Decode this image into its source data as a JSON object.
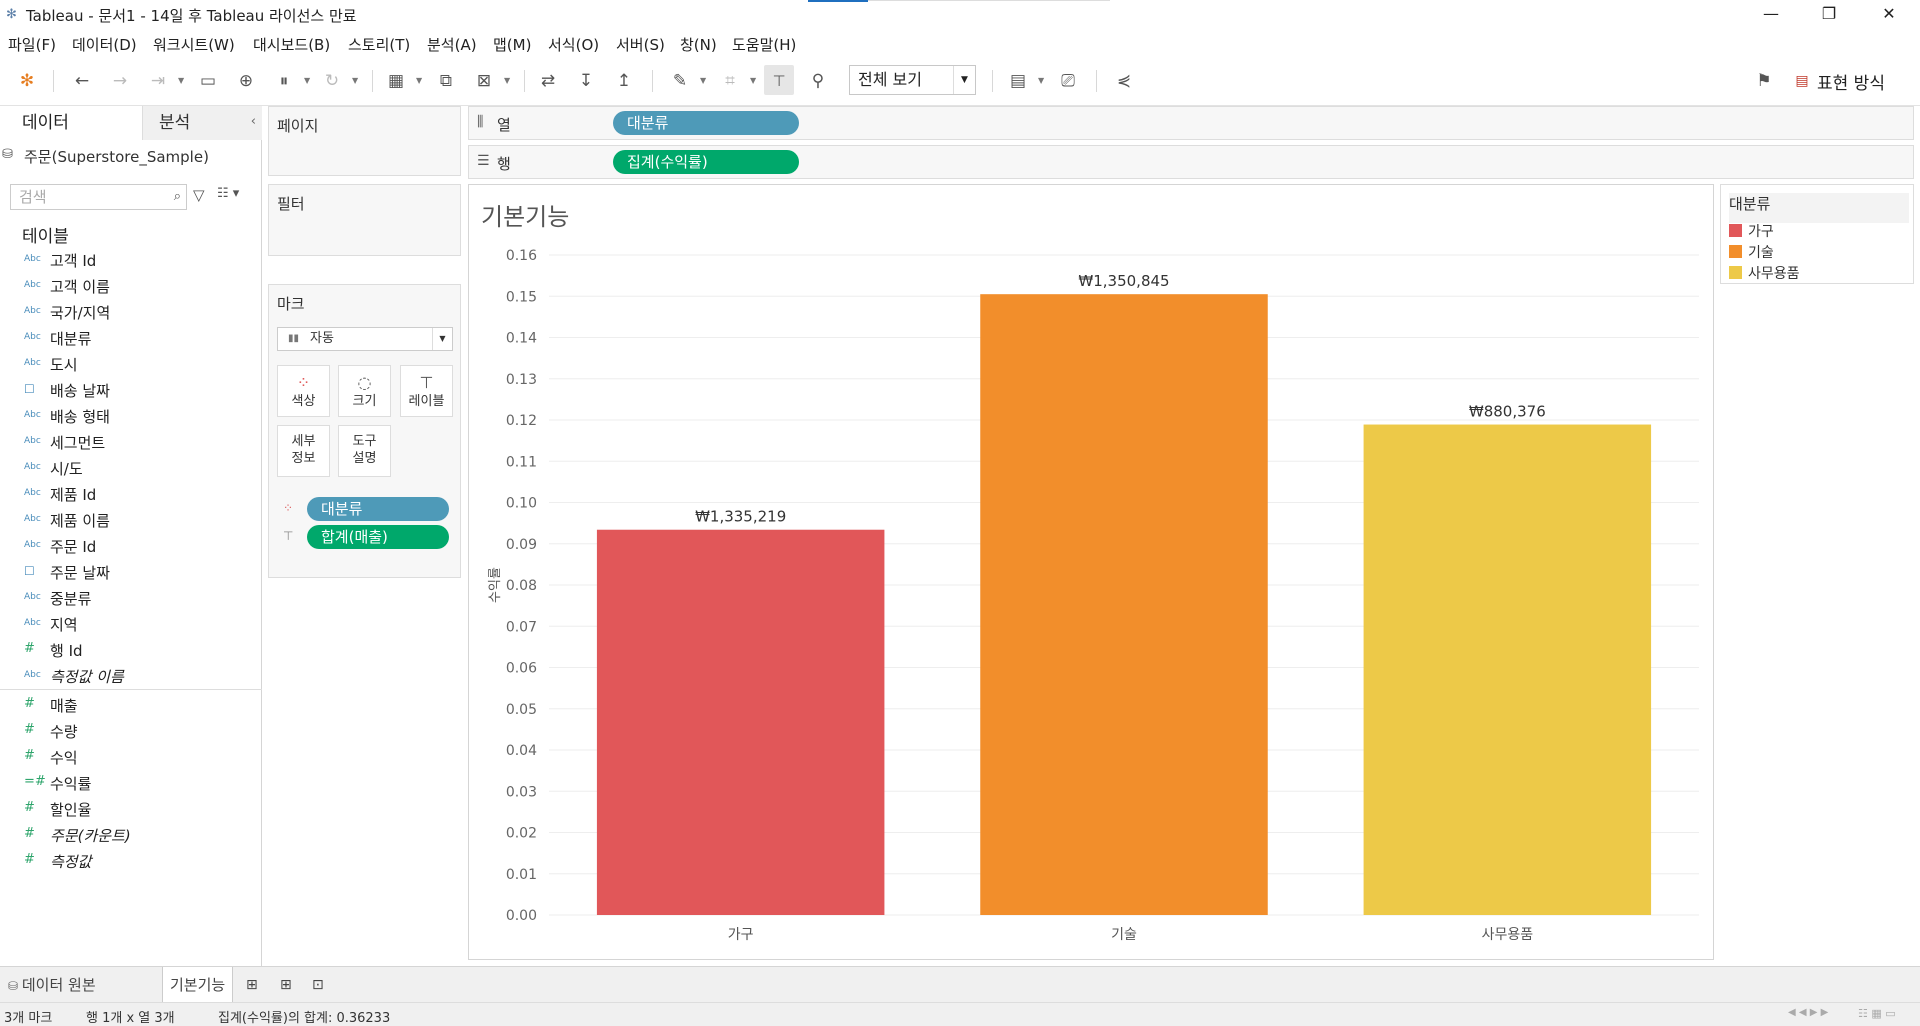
{
  "window": {
    "title": "Tableau - 문서1 - 14일 후 Tableau 라이선스 만료"
  },
  "menu": [
    "파일(F)",
    "데이터(D)",
    "워크시트(W)",
    "대시보드(B)",
    "스토리(T)",
    "분석(A)",
    "맵(M)",
    "서식(O)",
    "서버(S)",
    "창(N)",
    "도움말(H)"
  ],
  "toolbar": {
    "fit_label": "전체 보기",
    "show_me_label": "표현 방식"
  },
  "left_panel": {
    "tab_data": "데이터",
    "tab_analysis": "분석",
    "datasource": "주문(Superstore_Sample)",
    "search_placeholder": "검색",
    "tables_title": "테이블",
    "dimensions": [
      {
        "type": "Abc",
        "name": "고객 Id"
      },
      {
        "type": "Abc",
        "name": "고객 이름"
      },
      {
        "type": "Abc",
        "name": "국가/지역"
      },
      {
        "type": "Abc",
        "name": "대분류"
      },
      {
        "type": "Abc",
        "name": "도시"
      },
      {
        "type": "cal",
        "name": "배송 날짜"
      },
      {
        "type": "Abc",
        "name": "배송 형태"
      },
      {
        "type": "Abc",
        "name": "세그먼트"
      },
      {
        "type": "Abc",
        "name": "시/도"
      },
      {
        "type": "Abc",
        "name": "제품 Id"
      },
      {
        "type": "Abc",
        "name": "제품 이름"
      },
      {
        "type": "Abc",
        "name": "주문 Id"
      },
      {
        "type": "cal",
        "name": "주문 날짜"
      },
      {
        "type": "Abc",
        "name": "중분류"
      },
      {
        "type": "Abc",
        "name": "지역"
      },
      {
        "type": "#",
        "name": "행 Id"
      },
      {
        "type": "Abc",
        "name": "측정값 이름",
        "italic": true
      }
    ],
    "measures": [
      {
        "type": "#",
        "name": "매출"
      },
      {
        "type": "#",
        "name": "수량"
      },
      {
        "type": "#",
        "name": "수익"
      },
      {
        "type": "=#",
        "name": "수익률"
      },
      {
        "type": "#",
        "name": "할인율"
      },
      {
        "type": "#",
        "name": "주문(카운트)",
        "italic": true
      },
      {
        "type": "#",
        "name": "측정값",
        "italic": true
      }
    ]
  },
  "cards": {
    "pages": "페이지",
    "filters": "필터",
    "marks": "마크",
    "mark_type": "자동",
    "buttons": [
      "색상",
      "크기",
      "레이블"
    ],
    "detail": [
      "세부",
      "정보"
    ],
    "tooltip": [
      "도구",
      "설명"
    ],
    "mark_pills": [
      "대분류",
      "합계(매출)"
    ]
  },
  "shelves": {
    "columns_label": "열",
    "columns_pill": "대분류",
    "rows_label": "행",
    "rows_pill": "집계(수익률)"
  },
  "viz_title": "기본기능",
  "legend": {
    "title": "대분류",
    "items": [
      {
        "name": "가구",
        "color": "#e15759"
      },
      {
        "name": "기술",
        "color": "#f28e2b"
      },
      {
        "name": "사무용품",
        "color": "#edc948"
      }
    ]
  },
  "chart_data": {
    "type": "bar",
    "categories": [
      "가구",
      "기술",
      "사무용품"
    ],
    "values": [
      0.0934,
      0.1505,
      0.1189
    ],
    "labels": [
      "₩1,335,219",
      "₩1,350,845",
      "₩880,376"
    ],
    "colors": [
      "#e15759",
      "#f28e2b",
      "#edc948"
    ],
    "ylabel": "수익률",
    "yticks": [
      "0.00",
      "0.01",
      "0.02",
      "0.03",
      "0.04",
      "0.05",
      "0.06",
      "0.07",
      "0.08",
      "0.09",
      "0.10",
      "0.11",
      "0.12",
      "0.13",
      "0.14",
      "0.15",
      "0.16"
    ],
    "ylim": [
      0,
      0.16
    ],
    "grid": true
  },
  "bottom_tabs": {
    "datasource": "데이터 원본",
    "sheet": "기본기능"
  },
  "status": {
    "marks": "3개 마크",
    "rows_cols": "행 1개 x 열 3개",
    "sum": "집계(수익률)의 합계: 0.36233"
  }
}
